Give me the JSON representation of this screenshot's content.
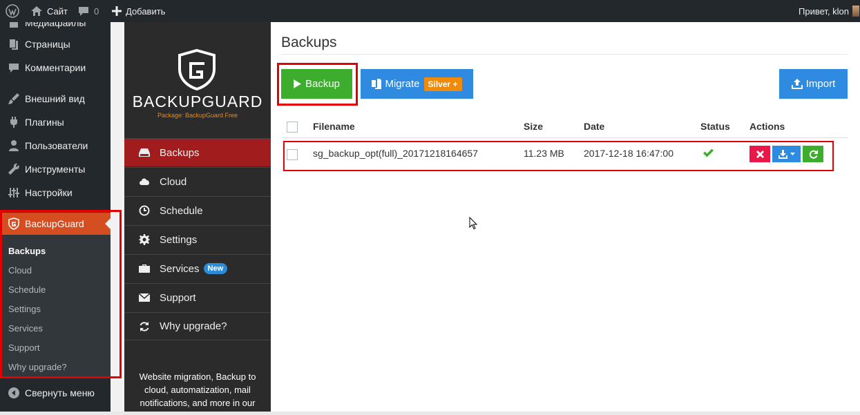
{
  "adminbar": {
    "site_label": "Сайт",
    "comments_count": "0",
    "add_label": "Добавить",
    "greeting": "Привет, klon"
  },
  "sidebar": {
    "items": [
      {
        "label": "Медиафайлы",
        "icon": "media-icon"
      },
      {
        "label": "Страницы",
        "icon": "pages-icon"
      },
      {
        "label": "Комментарии",
        "icon": "comments-icon"
      },
      {
        "label": "Внешний вид",
        "icon": "appearance-icon"
      },
      {
        "label": "Плагины",
        "icon": "plugins-icon"
      },
      {
        "label": "Пользователи",
        "icon": "users-icon"
      },
      {
        "label": "Инструменты",
        "icon": "tools-icon"
      },
      {
        "label": "Настройки",
        "icon": "settings-icon"
      }
    ],
    "active_item": {
      "label": "BackupGuard",
      "icon": "backupguard-shield-icon"
    },
    "submenu": [
      "Backups",
      "Cloud",
      "Schedule",
      "Settings",
      "Services",
      "Support",
      "Why upgrade?"
    ],
    "collapse_label": "Свернуть меню"
  },
  "plugin_nav": {
    "logo_text": "BACKUPGUARD",
    "package_label": "Package: BackupGuard Free",
    "items": [
      {
        "label": "Backups",
        "icon": "hard-drive-icon",
        "active": true
      },
      {
        "label": "Cloud",
        "icon": "cloud-icon"
      },
      {
        "label": "Schedule",
        "icon": "clock-icon"
      },
      {
        "label": "Settings",
        "icon": "gear-icon"
      },
      {
        "label": "Services",
        "icon": "briefcase-icon",
        "badge": "New"
      },
      {
        "label": "Support",
        "icon": "envelope-icon"
      },
      {
        "label": "Why upgrade?",
        "icon": "refresh-icon"
      }
    ],
    "footer_lines": [
      "Website migration, Backup to",
      "cloud, automatization, mail",
      "notifications, and more in our"
    ]
  },
  "main": {
    "title": "Backups",
    "buttons": {
      "backup": "Backup",
      "migrate": "Migrate",
      "migrate_badge": "Silver +",
      "import": "Import"
    },
    "table": {
      "columns": [
        "Filename",
        "Size",
        "Date",
        "Status",
        "Actions"
      ],
      "rows": [
        {
          "filename": "sg_backup_opt(full)_20171218164657",
          "size": "11.23 MB",
          "date": "2017-12-18 16:47:00",
          "status": "success"
        }
      ]
    }
  },
  "colors": {
    "wp_dark": "#23282d",
    "wp_accent": "#d54e21",
    "plugin_active": "#a11d1d",
    "backup_green": "#3dad2e",
    "blue": "#2f8be0",
    "delete_red": "#e8194a",
    "highlight_red": "#e50000"
  }
}
